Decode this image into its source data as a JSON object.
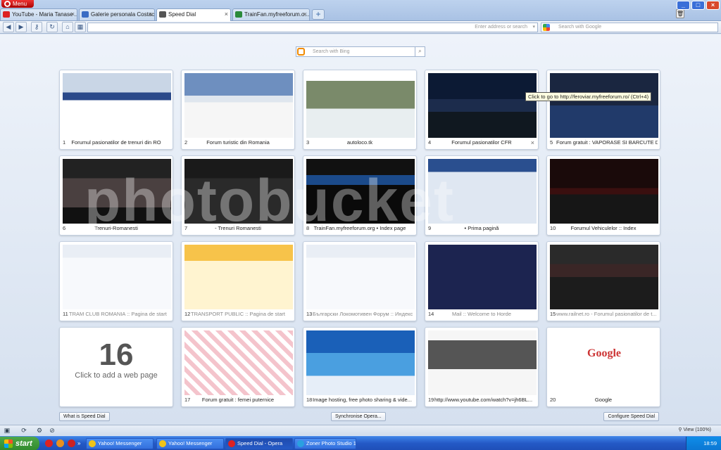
{
  "browser": {
    "menu_label": "Menu",
    "tabs": [
      {
        "label": "YouTube - Maria Tanase ...",
        "favicon": "youtube-icon",
        "color": "#d22"
      },
      {
        "label": "Galerie personala Costac...",
        "favicon": "page-icon",
        "color": "#3a6cc4"
      },
      {
        "label": "Speed Dial",
        "favicon": "speed-dial-icon",
        "color": "#555",
        "active": true
      },
      {
        "label": "TrainFan.myfreeforum.o...",
        "favicon": "forum-icon",
        "color": "#2a8a3a"
      }
    ],
    "new_tab": "+",
    "window_buttons": [
      "_",
      "□",
      "×"
    ],
    "address_placeholder": "Enter address or search",
    "search_placeholder": "Search with Google"
  },
  "speed_dial": {
    "bing_placeholder": "Search with Bing",
    "tooltip": "Click to go to http://feroviar.myfreeforum.ro/ (Ctrl+4)",
    "cells": [
      {
        "num": "1",
        "title": "Forumul pasionatilor de trenuri din RO",
        "theme": "snow"
      },
      {
        "num": "2",
        "title": "Forum turistic din Romania",
        "theme": "mountain"
      },
      {
        "num": "3",
        "title": "autoloco.tk",
        "theme": "loco"
      },
      {
        "num": "4",
        "title": "Forumul pasionatilor CFR",
        "theme": "dark-blue",
        "close": "×"
      },
      {
        "num": "5",
        "title": "Forum gratuit : VAPORASE SI BARCUTE DE...",
        "theme": "dark-navy"
      },
      {
        "num": "6",
        "title": "Trenuri-Romanesti",
        "theme": "dark-photo"
      },
      {
        "num": "7",
        "title": "- Trenuri Romanesti",
        "theme": "dark-gray"
      },
      {
        "num": "8",
        "title": "TrainFan.myfreeforum.org • Index page",
        "theme": "black-forum"
      },
      {
        "num": "9",
        "title": "• Prima pagină",
        "theme": "blue-forum"
      },
      {
        "num": "10",
        "title": "Forumul Vehiculelor :: Index",
        "theme": "dark-red"
      },
      {
        "num": "11",
        "title": "TRAM CLUB ROMANIA :: Pagina de start",
        "theme": "light-forum",
        "faded": true
      },
      {
        "num": "12",
        "title": "TRANSPORT PUBLIC :: Pagina de start",
        "theme": "yellow",
        "faded": true
      },
      {
        "num": "13",
        "title": "Български Локомотивен Форум :: Индекс",
        "theme": "light-forum",
        "faded": true
      },
      {
        "num": "14",
        "title": "Mail :: Welcome to Horde",
        "theme": "navy-login",
        "faded": true
      },
      {
        "num": "15",
        "title": "www.railnet.ro - Forumul pasionatilor de t...",
        "theme": "railnet",
        "faded": true
      },
      {
        "num": "",
        "title": "",
        "empty": true,
        "big": "16",
        "add": "Click to add a web page"
      },
      {
        "num": "17",
        "title": "Forum gratuit : femei puternice",
        "theme": "pink"
      },
      {
        "num": "18",
        "title": "Image hosting, free photo sharing & vide...",
        "theme": "photobucket"
      },
      {
        "num": "19",
        "title": "http://www.youtube.com/watch?v=jh6BL...",
        "theme": "youtube"
      },
      {
        "num": "20",
        "title": "Google",
        "theme": "google"
      }
    ],
    "watermark": "photobucket",
    "buttons": {
      "what_is": "What is Speed Dial",
      "synchronise": "Synchronise Opera...",
      "configure": "Configure Speed Dial"
    }
  },
  "statusbar": {
    "zoom": "View (100%)"
  },
  "taskbar": {
    "start": "start",
    "tasks": [
      {
        "label": "Yahoo! Messenger",
        "color": "#f0c419"
      },
      {
        "label": "Yahoo! Messenger",
        "color": "#f0c419"
      },
      {
        "label": "Speed Dial - Opera",
        "color": "#d22",
        "active": true
      },
      {
        "label": "Zoner Photo Studio 1...",
        "color": "#2aa0e0"
      }
    ],
    "clock": "18:59"
  }
}
